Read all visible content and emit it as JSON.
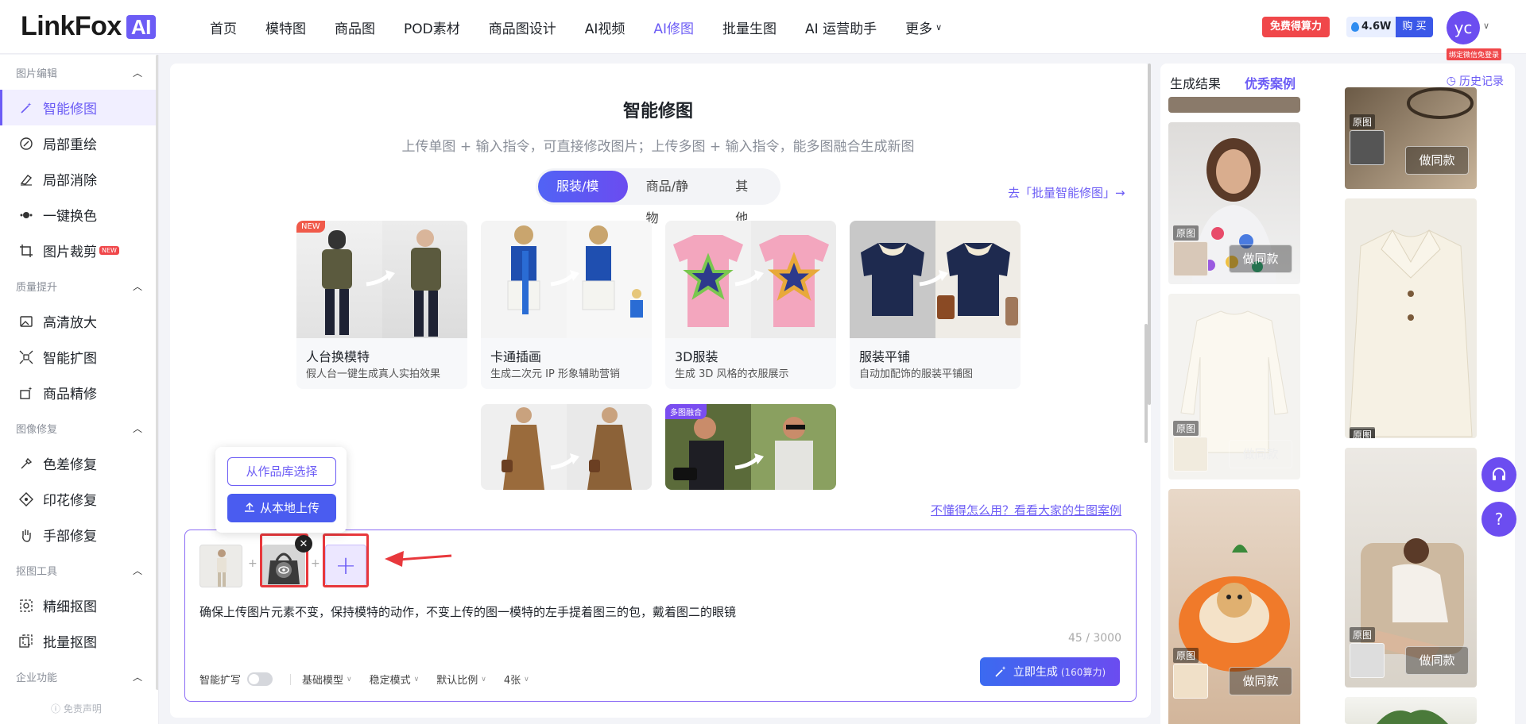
{
  "header": {
    "logo_text": "LinkFox",
    "logo_badge": "AI",
    "nav": [
      "首页",
      "模特图",
      "商品图",
      "POD素材",
      "商品图设计",
      "AI视频",
      "AI修图",
      "批量生图",
      "AI 运营助手",
      "更多"
    ],
    "active_nav": "AI修图",
    "free_power": "免费得算力",
    "power_amount": "4.6W",
    "buy": "购 买",
    "avatar_text": "yc",
    "bind_tag": "绑定微信免登录"
  },
  "sidebar": {
    "groups": [
      {
        "title": "图片编辑",
        "items": [
          "智能修图",
          "局部重绘",
          "局部消除",
          "一键换色",
          "图片裁剪"
        ]
      },
      {
        "title": "质量提升",
        "items": [
          "高清放大",
          "智能扩图",
          "商品精修"
        ]
      },
      {
        "title": "图像修复",
        "items": [
          "色差修复",
          "印花修复",
          "手部修复"
        ]
      },
      {
        "title": "抠图工具",
        "items": [
          "精细抠图",
          "批量抠图"
        ]
      },
      {
        "title": "企业功能",
        "items": []
      }
    ],
    "new_badge": "NEW",
    "disclaimer": "免责声明"
  },
  "main": {
    "title": "智能修图",
    "subtitle": "上传单图 + 输入指令，可直接修改图片；上传多图 + 输入指令，能多图融合生成新图",
    "tabs": [
      "服装/模特",
      "商品/静物",
      "其他"
    ],
    "batch_link": "去「批量智能修图」→",
    "cards": [
      {
        "title": "人台换模特",
        "desc": "假人台一键生成真人实拍效果",
        "tag": "NEW"
      },
      {
        "title": "卡通插画",
        "desc": "生成二次元 IP 形象辅助营销",
        "tag": ""
      },
      {
        "title": "3D服装",
        "desc": "生成 3D 风格的衣服展示",
        "tag": ""
      },
      {
        "title": "服装平铺",
        "desc": "自动加配饰的服装平铺图",
        "tag": ""
      },
      {
        "title": "",
        "desc": "",
        "tag": ""
      },
      {
        "title": "",
        "desc": "",
        "tag": "多图融合"
      }
    ],
    "help_link": "不懂得怎么用？看看大家的生图案例"
  },
  "popup": {
    "library": "从作品库选择",
    "local": "从本地上传"
  },
  "prompt": {
    "text": "确保上传图片元素不变，保持模特的动作，不变上传的图一模特的左手提着图三的包，戴着图二的眼镜",
    "counter": "45 / 3000",
    "smart_expand": "智能扩写",
    "model": "基础模型",
    "mode": "稳定模式",
    "ratio": "默认比例",
    "count": "4张",
    "generate": "立即生成",
    "cost": "(160算力)"
  },
  "right": {
    "tabs": [
      "生成结果",
      "优秀案例"
    ],
    "history": "历史记录",
    "orig_label": "原图",
    "same_label": "做同款"
  },
  "colors": {
    "accent": "#6c5cf5",
    "red": "#e8383c",
    "blue": "#3b58e8"
  }
}
